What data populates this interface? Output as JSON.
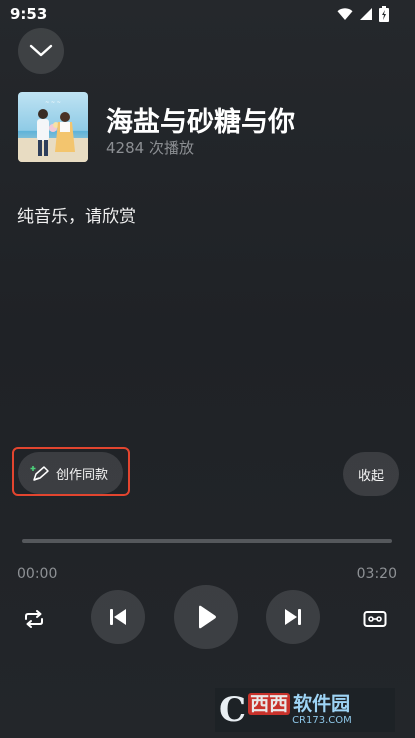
{
  "status_bar": {
    "time": "9:53"
  },
  "song": {
    "title": "海盐与砂糖与你",
    "play_count": "4284 次播放"
  },
  "lyrics": {
    "text": "纯音乐，请欣赏"
  },
  "actions": {
    "create_label": "创作同款",
    "collapse_label": "收起"
  },
  "progress": {
    "current": "00:00",
    "total": "03:20",
    "fraction": 0
  },
  "watermark": {
    "letter": "C",
    "main_red": "西西",
    "main_blue": "软件园",
    "sub": "CR173.COM"
  },
  "icons": {
    "collapse": "chevron-down-icon",
    "repeat": "repeat-icon",
    "previous": "skip-previous-icon",
    "play": "play-icon",
    "next": "skip-next-icon",
    "extra": "cassette-icon",
    "create": "pencil-sparkle-icon"
  },
  "colors": {
    "highlight": "#e2452f",
    "secondary_text": "#8c8f93"
  }
}
